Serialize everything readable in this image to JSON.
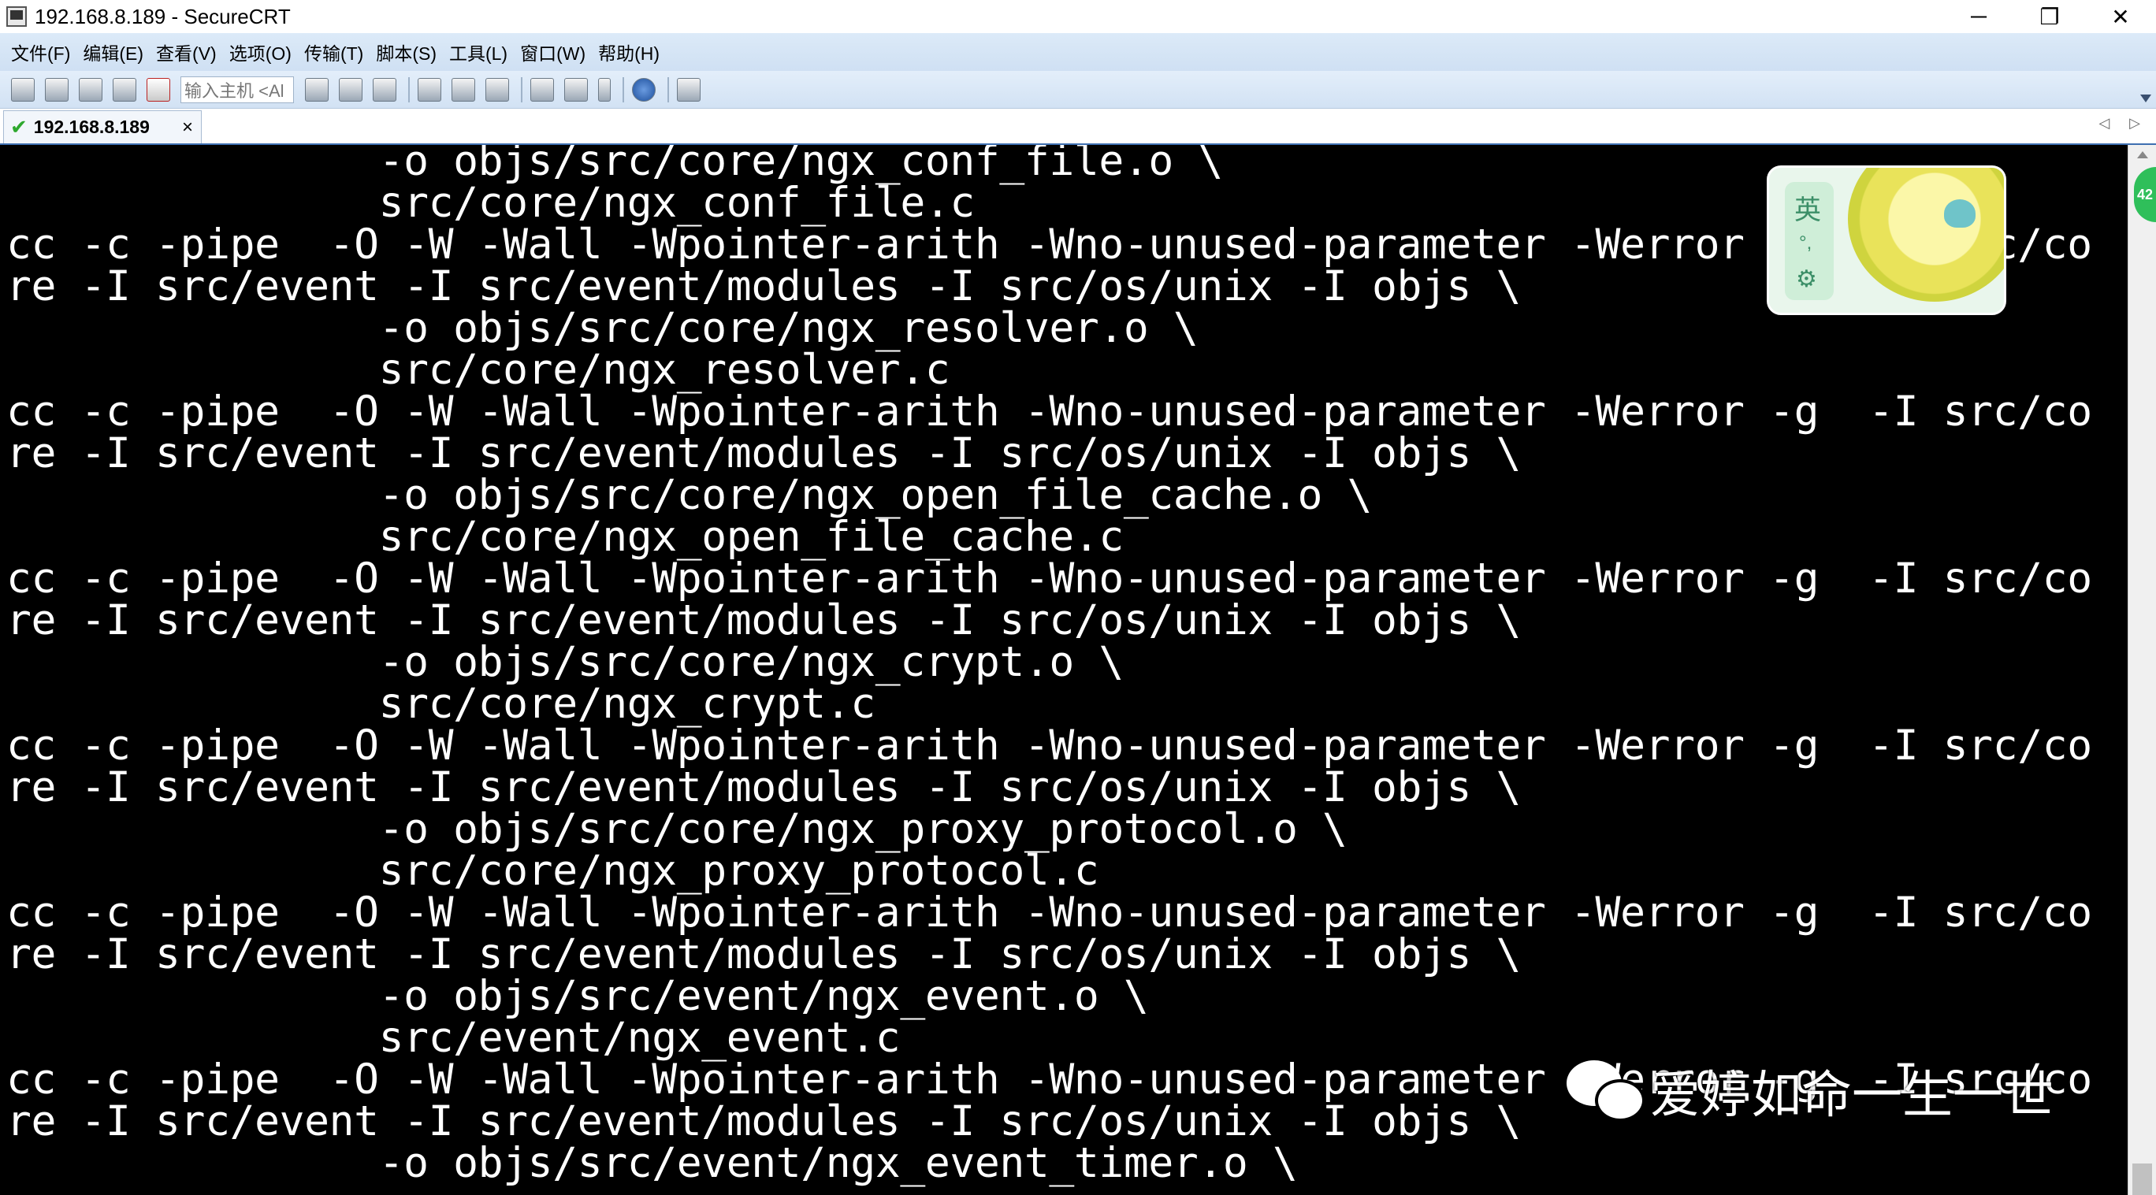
{
  "window": {
    "title": "192.168.8.189 - SecureCRT",
    "controls": {
      "minimize": "─",
      "restore": "❐",
      "close": "✕"
    }
  },
  "menu": {
    "items": [
      "文件(F)",
      "编辑(E)",
      "查看(V)",
      "选项(O)",
      "传输(T)",
      "脚本(S)",
      "工具(L)",
      "窗口(W)",
      "帮助(H)"
    ]
  },
  "toolbar": {
    "host_input_value": "输入主机 <Al",
    "icons_left": [
      "connect-icon",
      "quick-connect-icon",
      "connect-in-tab-icon",
      "reconnect-icon",
      "disconnect-icon"
    ],
    "icons_right": [
      "copy-icon",
      "paste-icon",
      "find-icon",
      "print-screen-icon",
      "print-selection-icon",
      "print-icon",
      "session-options-icon",
      "global-options-icon",
      "keymap-icon",
      "help-icon",
      "sftp-icon"
    ]
  },
  "tab": {
    "label": "192.168.8.189",
    "status_icon": "connected-check-icon",
    "close": "×",
    "nav": "◁ ▷"
  },
  "terminal": {
    "lines": [
      "               -o objs/src/core/ngx_conf_file.o \\",
      "               src/core/ngx_conf_file.c",
      "cc -c -pipe  -O -W -Wall -Wpointer-arith -Wno-unused-parameter -Werror -g  -I src/co",
      "re -I src/event -I src/event/modules -I src/os/unix -I objs \\",
      "               -o objs/src/core/ngx_resolver.o \\",
      "               src/core/ngx_resolver.c",
      "cc -c -pipe  -O -W -Wall -Wpointer-arith -Wno-unused-parameter -Werror -g  -I src/co",
      "re -I src/event -I src/event/modules -I src/os/unix -I objs \\",
      "               -o objs/src/core/ngx_open_file_cache.o \\",
      "               src/core/ngx_open_file_cache.c",
      "cc -c -pipe  -O -W -Wall -Wpointer-arith -Wno-unused-parameter -Werror -g  -I src/co",
      "re -I src/event -I src/event/modules -I src/os/unix -I objs \\",
      "               -o objs/src/core/ngx_crypt.o \\",
      "               src/core/ngx_crypt.c",
      "cc -c -pipe  -O -W -Wall -Wpointer-arith -Wno-unused-parameter -Werror -g  -I src/co",
      "re -I src/event -I src/event/modules -I src/os/unix -I objs \\",
      "               -o objs/src/core/ngx_proxy_protocol.o \\",
      "               src/core/ngx_proxy_protocol.c",
      "cc -c -pipe  -O -W -Wall -Wpointer-arith -Wno-unused-parameter -Werror -g  -I src/co",
      "re -I src/event -I src/event/modules -I src/os/unix -I objs \\",
      "               -o objs/src/event/ngx_event.o \\",
      "               src/event/ngx_event.c",
      "cc -c -pipe  -O -W -Wall -Wpointer-arith -Wno-unused-parameter -Werror -g  -I src/co",
      "re -I src/event -I src/event/modules -I src/os/unix -I objs \\",
      "               -o objs/src/event/ngx_event_timer.o \\"
    ]
  },
  "ime": {
    "mode_char": "英",
    "punct": "°,",
    "settings": "⚙"
  },
  "side_badge": "42",
  "watermark": {
    "text": "爱婷如命一生一世"
  },
  "colors": {
    "terminal_bg": "#000000",
    "terminal_fg": "#ffffff",
    "menubar_bg": "#d6e6f6",
    "tab_accent": "#3e6fb0"
  }
}
